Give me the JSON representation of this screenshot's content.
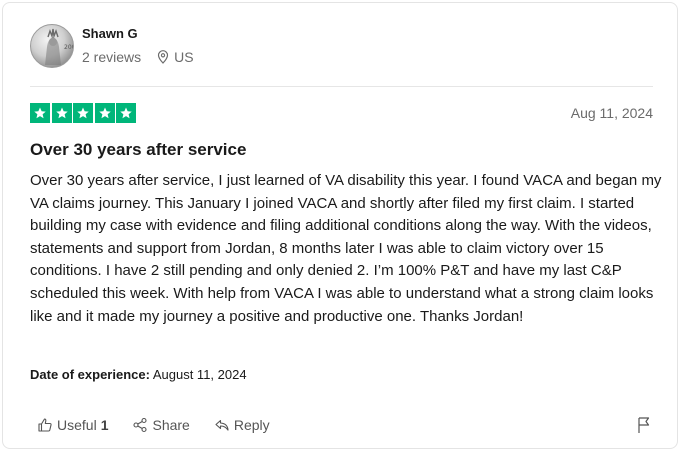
{
  "reviewer": {
    "name": "Shawn G",
    "reviews_count": "2 reviews",
    "location": "US",
    "avatar_icon": "coin-avatar-icon"
  },
  "review": {
    "rating": 5,
    "rating_max": 5,
    "star_color": "#00b67a",
    "date": "Aug 11, 2024",
    "title": "Over 30 years after service",
    "body": "Over 30 years after service, I just learned of VA disability this year. I found VACA and began my VA claims journey. This January I joined VACA and shortly after filed my first claim. I started building my case with evidence and filing additional conditions along the way. With the videos, statements and support from Jordan, 8 months later I was able to claim victory over 15 conditions. I have 2 still pending and only denied 2. I’m 100% P&T and have my last C&P scheduled this week. With help from VACA I was able to understand what a strong claim looks like and it made my journey a positive and productive one. Thanks Jordan!",
    "experience_label": "Date of experience:",
    "experience_date": "August 11, 2024"
  },
  "actions": {
    "useful_label": "Useful",
    "useful_count": "1",
    "share_label": "Share",
    "reply_label": "Reply",
    "icons": [
      "thumbs-up-icon",
      "share-icon",
      "reply-icon",
      "flag-icon"
    ]
  }
}
